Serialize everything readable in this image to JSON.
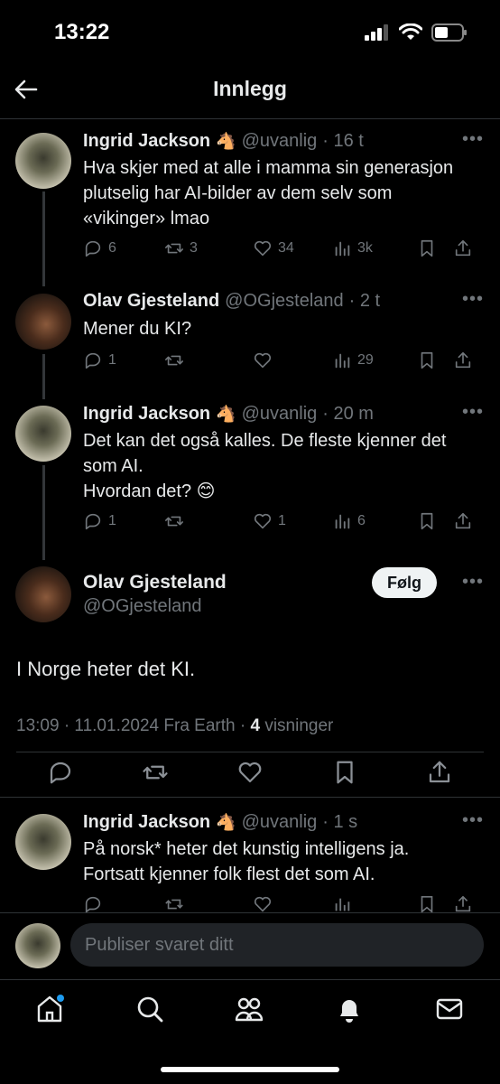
{
  "status": {
    "time": "13:22"
  },
  "header": {
    "title": "Innlegg"
  },
  "tweets": [
    {
      "name": "Ingrid Jackson",
      "badge": "🐴",
      "handle": "@uvanlig",
      "time": "· 16 t",
      "lines": [
        "Hva skjer med at alle i mamma sin generasjon",
        "plutselig har AI-bilder av dem selv som",
        "«vikinger» lmao"
      ],
      "replies": "6",
      "retweets": "3",
      "likes": "34",
      "views": "3k"
    },
    {
      "name": "Olav Gjesteland",
      "handle": "@OGjesteland",
      "time": "· 2 t",
      "lines": [
        "Mener du KI?"
      ],
      "replies": "1",
      "retweets": "",
      "likes": "",
      "views": "29"
    },
    {
      "name": "Ingrid Jackson",
      "badge": "🐴",
      "handle": "@uvanlig",
      "time": "· 20 m",
      "lines": [
        "Det kan det også kalles. De fleste kjenner det",
        "som AI.",
        "Hvordan det? 😊"
      ],
      "replies": "1",
      "retweets": "",
      "likes": "1",
      "views": "6"
    }
  ],
  "main": {
    "name": "Olav Gjesteland",
    "handle": "@OGjesteland",
    "follow_label": "Følg",
    "text": "I Norge heter det KI.",
    "meta_prefix": "13:09 · 11.01.2024 Fra Earth · ",
    "views_count": "4",
    "views_label": " visninger"
  },
  "reply": {
    "name": "Ingrid Jackson",
    "badge": "🐴",
    "handle": "@uvanlig",
    "time": "· 1 s",
    "lines": [
      "På norsk* heter det kunstig intelligens ja.",
      "Fortsatt kjenner folk flest det som AI."
    ]
  },
  "composer": {
    "placeholder": "Publiser svaret ditt"
  },
  "colors": {
    "background": "#000000",
    "text": "#e7e9ea",
    "muted": "#71767b",
    "accent": "#1d9bf0",
    "divider": "#2f3336"
  }
}
